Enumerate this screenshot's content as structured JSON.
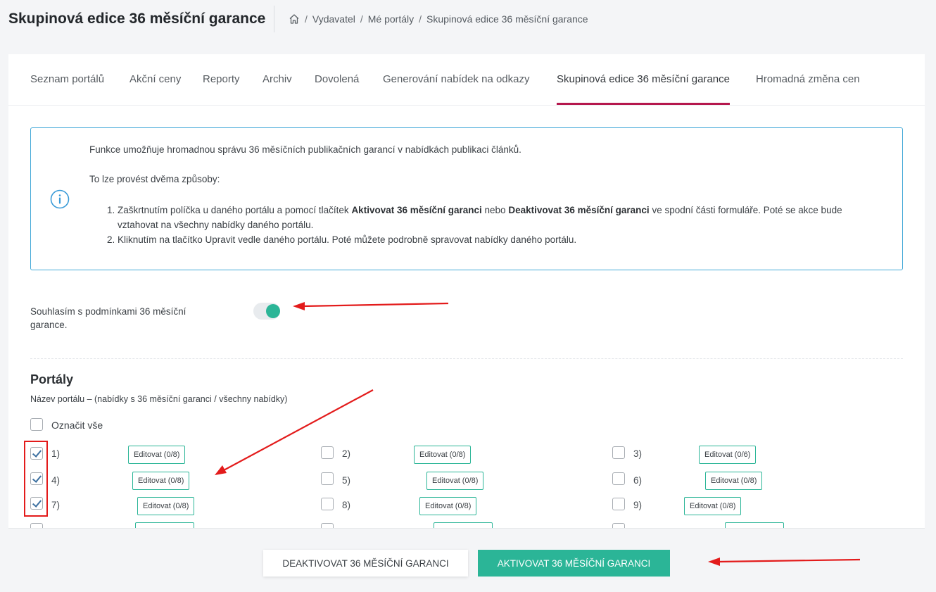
{
  "header": {
    "title": "Skupinová edice 36 měsíční garance",
    "breadcrumb": [
      "Vydavatel",
      "Mé portály",
      "Skupinová edice 36 měsíční garance"
    ]
  },
  "tabs": [
    {
      "label": "Seznam portálů",
      "active": false
    },
    {
      "label": "Akční ceny",
      "active": false
    },
    {
      "label": "Reporty",
      "active": false
    },
    {
      "label": "Archiv",
      "active": false
    },
    {
      "label": "Dovolená",
      "active": false
    },
    {
      "label": "Generování nabídek na odkazy",
      "active": false
    },
    {
      "label": "Skupinová edice 36 měsíční garance",
      "active": true
    },
    {
      "label": "Hromadná změna cen",
      "active": false
    }
  ],
  "info": {
    "intro": "Funkce umožňuje hromadnou správu 36 měsíčních publikačních garancí v nabídkách publikaci článků.",
    "ways": "To lze provést dvěma způsoby:",
    "step1_a": "Zaškrtnutím políčka u daného portálu a pomocí tlačítek ",
    "step1_b": "Aktivovat 36 měsíční garanci",
    "step1_c": " nebo ",
    "step1_d": "Deaktivovat 36 měsíční garanci",
    "step1_e": " ve spodní části formuláře. Poté se akce bude vztahovat na všechny nabídky daného portálu.",
    "step2": "Kliknutím na tlačítko Upravit vedle daného portálu. Poté můžete podrobně spravovat nabídky daného portálu."
  },
  "consent": {
    "label": "Souhlasím s podmínkami 36 měsíční garance.",
    "enabled": true
  },
  "portals": {
    "title": "Portály",
    "subtitle": "Název portálu – (nabídky s 36 měsíční garanci / všechny nabídky)",
    "select_all": "Označit vše",
    "items": [
      {
        "label": "1)",
        "edit": "Editovat (0/8)",
        "checked": true
      },
      {
        "label": "2)",
        "edit": "Editovat (0/8)",
        "checked": false
      },
      {
        "label": "3)",
        "edit": "Editovat (0/6)",
        "checked": false
      },
      {
        "label": "4)",
        "edit": "Editovat (0/8)",
        "checked": true
      },
      {
        "label": "5)",
        "edit": "Editovat (0/8)",
        "checked": false
      },
      {
        "label": "6)",
        "edit": "Editovat (0/8)",
        "checked": false
      },
      {
        "label": "7)",
        "edit": "Editovat (0/8)",
        "checked": true
      },
      {
        "label": "8)",
        "edit": "Editovat (0/8)",
        "checked": false
      },
      {
        "label": "9)",
        "edit": "Editovat (0/8)",
        "checked": false
      }
    ]
  },
  "footer": {
    "deactivate": "DEAKTIVOVAT 36 MĚSÍČNÍ GARANCI",
    "activate": "AKTIVOVAT 36 MĚSÍČNÍ GARANCI"
  },
  "colors": {
    "accent": "#2bb597",
    "active_tab": "#b5174d",
    "info_border": "#45a9d8",
    "annotation": "#e31b1b"
  }
}
